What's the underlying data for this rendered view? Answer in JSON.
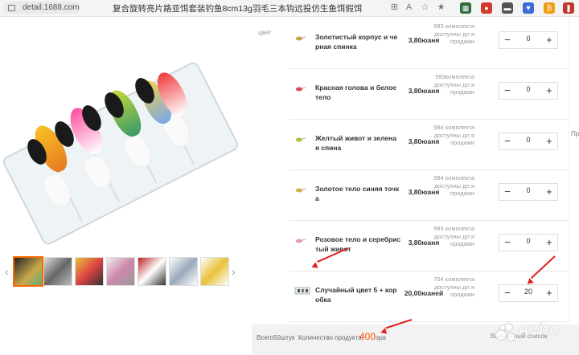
{
  "browser": {
    "url": "detail.1688.com",
    "title": "复合旋转亮片路亚饵套装钓鱼8cm13g羽毛三本钩远投仿生鱼饵假饵"
  },
  "variants": {
    "color_label": "цвет",
    "rows": [
      {
        "name": "Золотистый корпус и че рная спинка",
        "price": "3,80юаня",
        "stock": "993 комплекта доступны дл я продажи",
        "qty": "0"
      },
      {
        "name": "Красная голова и белое тело",
        "price": "3,80юаня",
        "stock": "993комплекта доступны дл я продажи",
        "qty": "0"
      },
      {
        "name": "Желтый живот и зелена я спина",
        "price": "3,80юаня",
        "stock": "994 комплекта доступны дл я продажи",
        "qty": "0"
      },
      {
        "name": "Золотое тело синяя точк а",
        "price": "3,80юаня",
        "stock": "994 комплекта доступны дл я продажи",
        "qty": "0"
      },
      {
        "name": "Розовое тело и серебрис тый живот",
        "price": "3,80юаня",
        "stock": "993 комплекта доступны дл я продажи",
        "qty": "0"
      },
      {
        "name": "Случайный цвет 5 + кор обка",
        "price": "20,00юаней",
        "stock": "754 комплекта доступны дл я продажи",
        "qty": "20"
      }
    ]
  },
  "stepper": {
    "minus": "−",
    "plus": "+"
  },
  "footer": {
    "total_pcs": "Всего50штук",
    "qty_label": "Количество продукта:",
    "qty_value": "400",
    "qty_unit": "эра",
    "list_button": "Выбранный список"
  },
  "edge_text": "Пр",
  "watermark": "Avito",
  "colors": {
    "accent": "#ff5000",
    "annotation": "#e02020"
  },
  "icons": [
    "lock-icon",
    "translate-icon",
    "favorite-icon",
    "bookmark-icon",
    "reader-icon",
    "minus-icon",
    "plus-icon",
    "chevron-left-icon",
    "chevron-right-icon"
  ]
}
